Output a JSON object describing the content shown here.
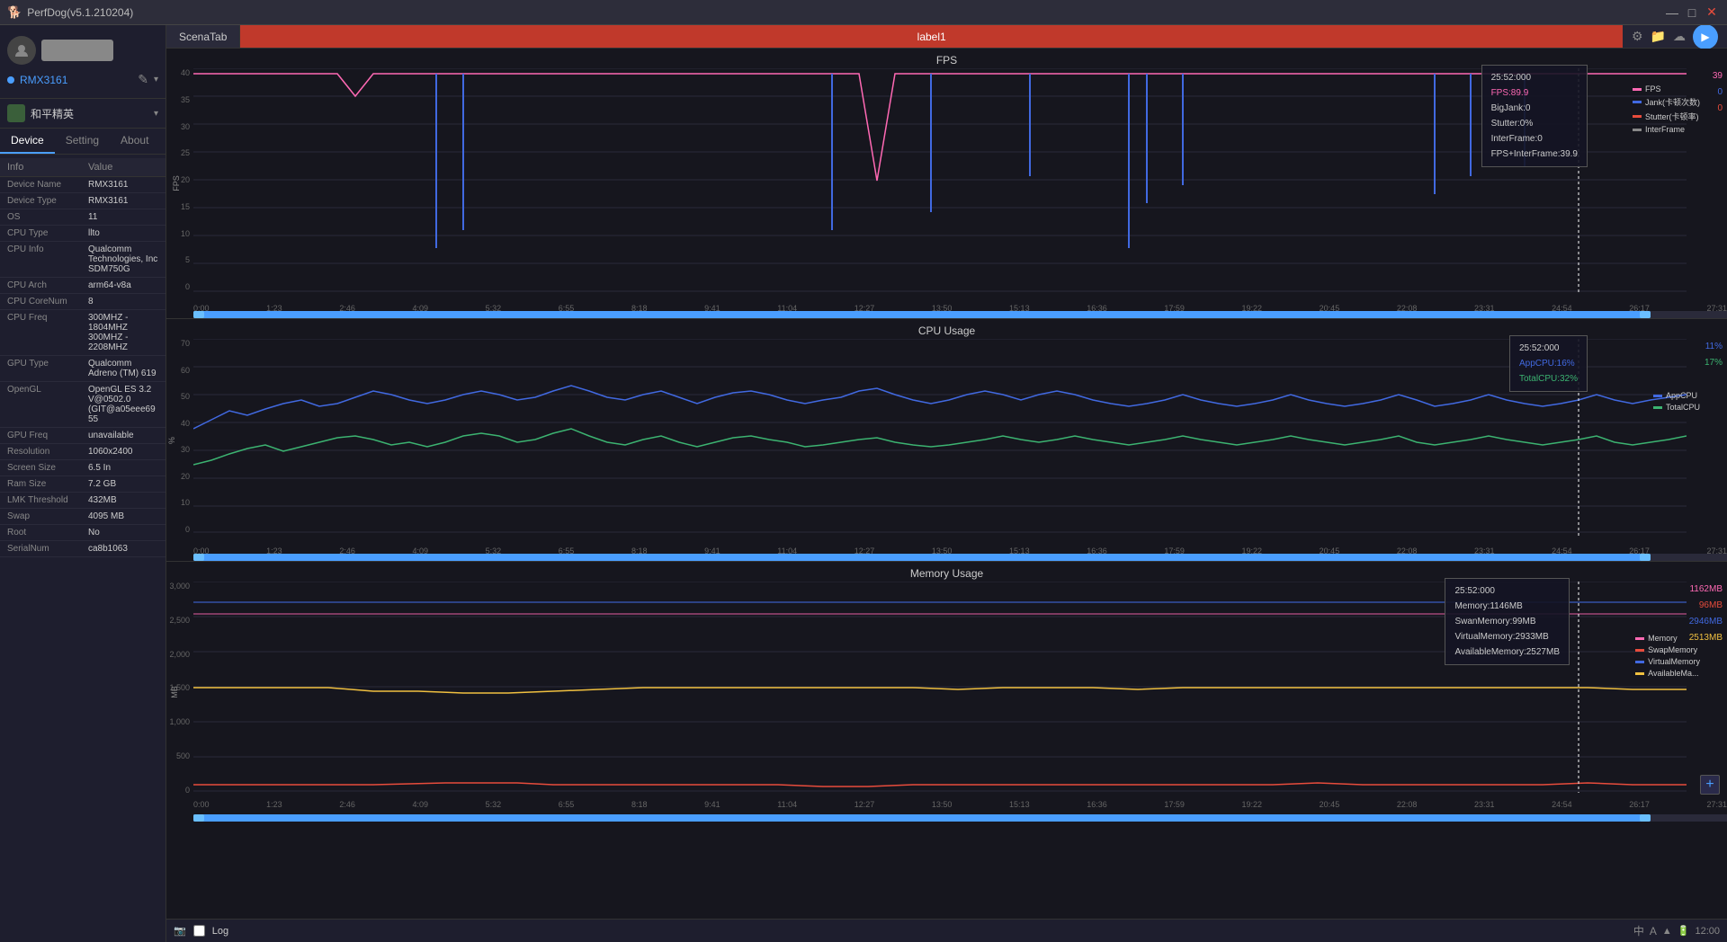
{
  "titlebar": {
    "title": "PerfDog(v5.1.210204)",
    "minimize": "—",
    "maximize": "□",
    "close": "✕"
  },
  "device": {
    "name": "RMX3161",
    "app": "和平精英"
  },
  "tabs": [
    "Device",
    "Setting",
    "About"
  ],
  "active_tab": "Device",
  "info_header": [
    "Info",
    "Value"
  ],
  "info_rows": [
    [
      "Device Name",
      "RMX3161"
    ],
    [
      "Device Type",
      "RMX3161"
    ],
    [
      "OS",
      "11"
    ],
    [
      "CPU Type",
      "llto"
    ],
    [
      "CPU Info",
      "Qualcomm Technologies, Inc SDM750G"
    ],
    [
      "CPU Arch",
      "arm64-v8a"
    ],
    [
      "CPU CoreNum",
      "8"
    ],
    [
      "CPU Freq",
      "300MHZ - 1804MHZ\n300MHZ - 2208MHZ"
    ],
    [
      "GPU Type",
      "Qualcomm Adreno (TM) 619"
    ],
    [
      "OpenGL",
      "OpenGL ES 3.2 V@0502.0 (GIT@a05eee6955"
    ],
    [
      "GPU Freq",
      "unavailable"
    ],
    [
      "Resolution",
      "1060x2400"
    ],
    [
      "Screen Size",
      "6.5 In"
    ],
    [
      "Ram Size",
      "7.2 GB"
    ],
    [
      "LMK Threshold",
      "432MB"
    ],
    [
      "Swap",
      "4095 MB"
    ],
    [
      "Root",
      "No"
    ],
    [
      "SerialNum",
      "ca8b1063"
    ]
  ],
  "scenatab": "ScenaTab",
  "label1": "label1",
  "charts": {
    "fps": {
      "title": "FPS",
      "y_ticks": [
        "40",
        "35",
        "30",
        "25",
        "20",
        "15",
        "10",
        "5",
        "0"
      ],
      "x_labels": [
        "0:00",
        "1:23",
        "2:46",
        "4:09",
        "5:32",
        "6:55",
        "8:18",
        "9:41",
        "11:04",
        "12:27",
        "13:50",
        "15:13",
        "16:36",
        "17:59",
        "19:22",
        "20:45",
        "22:08",
        "23:31",
        "24:54",
        "26:17",
        "27:31"
      ],
      "tooltip": {
        "time": "25:52:000",
        "fps": "FPS:89.9",
        "bigjanko": "BigJank:0",
        "stutter": "Stutter:0%",
        "interframe": "InterFrame:0",
        "fps_interframe": "FPS+InterFrame:39.9"
      },
      "legend": [
        {
          "label": "FPS",
          "color": "#ff69b4"
        },
        {
          "label": "Jank(卡顿次数)",
          "color": "#4169e1"
        },
        {
          "label": "Stutter(卡顿率)",
          "color": "#e74c3c"
        },
        {
          "label": "InterFrame",
          "color": "#888888"
        }
      ],
      "right_labels": [
        "39",
        "0",
        "0"
      ]
    },
    "cpu": {
      "title": "CPU Usage",
      "y_ticks": [
        "70",
        "60",
        "50",
        "40",
        "30",
        "20",
        "10",
        "0"
      ],
      "x_labels": [
        "0:00",
        "1:23",
        "2:46",
        "4:09",
        "5:32",
        "6:55",
        "8:18",
        "9:41",
        "11:04",
        "12:27",
        "13:50",
        "15:13",
        "16:36",
        "17:59",
        "19:22",
        "20:45",
        "22:08",
        "23:31",
        "24:54",
        "26:17",
        "27:31"
      ],
      "y_label": "%",
      "tooltip": {
        "time": "25:52:000",
        "appcpu": "AppCPU:16%",
        "totalcpu": "TotalCPU:32%"
      },
      "legend": [
        {
          "label": "AppCPU",
          "color": "#4169e1"
        },
        {
          "label": "TotalCPU",
          "color": "#3cb371"
        }
      ],
      "right_labels": [
        "11%",
        "17%"
      ]
    },
    "memory": {
      "title": "Memory Usage",
      "y_ticks": [
        "3,000",
        "2,500",
        "2,000",
        "1,500",
        "1,000",
        "500",
        "0"
      ],
      "x_labels": [
        "0:00",
        "1:23",
        "2:46",
        "4:09",
        "5:32",
        "6:55",
        "8:18",
        "9:41",
        "11:04",
        "12:27",
        "13:50",
        "15:13",
        "16:36",
        "17:59",
        "19:22",
        "20:45",
        "22:08",
        "23:31",
        "24:54",
        "26:17",
        "27:31"
      ],
      "y_label": "MB",
      "tooltip": {
        "time": "25:52:000",
        "memory": "Memory:1146MB",
        "swapMemory": "SwanMemory:99MB",
        "virtualMemory": "VirtualMemory:2933MB",
        "availableMemory": "AvailableMemory:2527MB"
      },
      "legend": [
        {
          "label": "Memory",
          "color": "#ff69b4"
        },
        {
          "label": "SwapMemory",
          "color": "#e74c3c"
        },
        {
          "label": "VirtualMemory",
          "color": "#4169e1"
        },
        {
          "label": "AvailableMa...",
          "color": "#f0c040"
        }
      ],
      "right_labels": [
        "1162MB",
        "96MB",
        "2946MB",
        "2513MB"
      ]
    }
  },
  "bottom": {
    "log_label": "Log",
    "sys_time": "中",
    "sys_icons": [
      "中",
      "A",
      "▲"
    ]
  }
}
